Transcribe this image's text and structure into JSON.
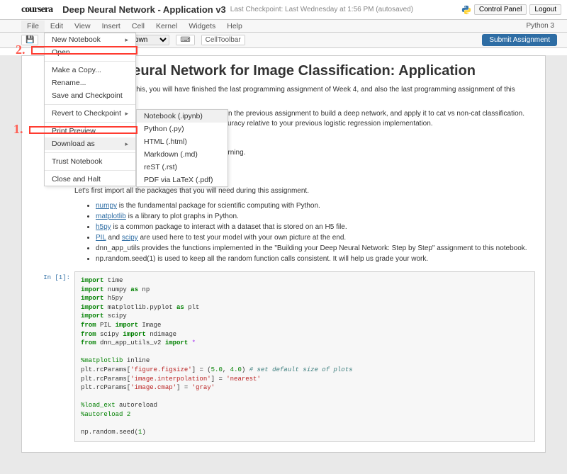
{
  "brand": "coursera",
  "doc": {
    "title": "Deep Neural Network - Application v3",
    "checkpoint": "Last Checkpoint: Last Wednesday at 1:56 PM (autosaved)"
  },
  "header_buttons": {
    "control": "Control Panel",
    "logout": "Logout"
  },
  "menubar": [
    "File",
    "Edit",
    "View",
    "Insert",
    "Cell",
    "Kernel",
    "Widgets",
    "Help"
  ],
  "kernel": "Python 3",
  "toolbar": {
    "save": "💾",
    "select_value": "Markdown",
    "keyboard": "⌨",
    "celltoolbar": "CellToolbar",
    "submit": "Submit Assignment"
  },
  "file_menu": {
    "new": "New Notebook",
    "open": "Open...",
    "copy": "Make a Copy...",
    "rename": "Rename...",
    "save": "Save and Checkpoint",
    "revert": "Revert to Checkpoint",
    "print": "Print Preview",
    "download": "Download as",
    "trust": "Trust Notebook",
    "close": "Close and Halt"
  },
  "download_submenu": [
    "Notebook (.ipynb)",
    "Python (.py)",
    "HTML (.html)",
    "Markdown (.md)",
    "reST (.rst)",
    "PDF via LaTeX (.pdf)"
  ],
  "annotations": {
    "one": "2.",
    "two": "1."
  },
  "notebook": {
    "h1": "p Neural Network for Image Classification: Application",
    "p1": "u finish this, you will have finished the last programming assignment of Week 4, and also the last programming assignment of this course!",
    "p2": "use the functions you'd implemented in the previous assignment to build a deep network, and apply it to cat vs non-cat classification. Hopefully, see an improvement in accuracy relative to your previous logistic regression implementation.",
    "able": "e able to:",
    "bullet1": "l network to supervised learning.",
    "h2": "1 - Pa",
    "p3": "Let's first import all the packages that you will need during this assignment.",
    "pkg": [
      {
        "name": "numpy",
        "rest": " is the fundamental package for scientific computing with Python."
      },
      {
        "name": "matplotlib",
        "rest": " is a library to plot graphs in Python."
      },
      {
        "name": "h5py",
        "rest": " is a common package to interact with a dataset that is stored on an H5 file."
      },
      {
        "name": "PIL",
        "name2": "scipy",
        "conj": " and ",
        "rest": " are used here to test your model with your own picture at the end."
      },
      {
        "plain": "dnn_app_utils provides the functions implemented in the \"Building your Deep Neural Network: Step by Step\" assignment to this notebook."
      },
      {
        "plain": "np.random.seed(1) is used to keep all the random function calls consistent. It will help us grade your work."
      }
    ],
    "cell": {
      "prompt": "In [1]:",
      "code_html": "<span class='kw'>import</span> time\n<span class='kw'>import</span> numpy <span class='kw'>as</span> np\n<span class='kw'>import</span> h5py\n<span class='kw'>import</span> matplotlib.pyplot <span class='kw'>as</span> plt\n<span class='kw'>import</span> scipy\n<span class='kw'>from</span> PIL <span class='kw'>import</span> Image\n<span class='kw'>from</span> scipy <span class='kw'>import</span> ndimage\n<span class='kw'>from</span> dnn_app_utils_v2 <span class='kw'>import</span> <span class='op'>*</span>\n\n<span class='mg'>%matplotlib</span> inline\nplt.rcParams[<span class='st'>'figure.figsize'</span>] = (<span class='num'>5.0</span>, <span class='num'>4.0</span>) <span class='cm'># set default size of plots</span>\nplt.rcParams[<span class='st'>'image.interpolation'</span>] = <span class='st'>'nearest'</span>\nplt.rcParams[<span class='st'>'image.cmap'</span>] = <span class='st'>'gray'</span>\n\n<span class='mg'>%load_ext</span> autoreload\n<span class='mg'>%autoreload</span> <span class='num'>2</span>\n\nnp.random.seed(<span class='num'>1</span>)"
    }
  }
}
